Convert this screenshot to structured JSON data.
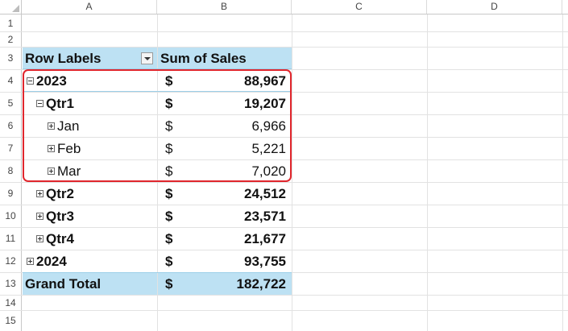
{
  "columns": [
    "A",
    "B",
    "C",
    "D"
  ],
  "rows": [
    "1",
    "2",
    "3",
    "4",
    "5",
    "6",
    "7",
    "8",
    "9",
    "10",
    "11",
    "12",
    "13",
    "14",
    "15"
  ],
  "pivot": {
    "header": {
      "row_labels": "Row Labels",
      "sum_of_sales": "Sum of Sales"
    },
    "entries": [
      {
        "label": "2023",
        "currency": "$",
        "value": "88,967"
      },
      {
        "label": "Qtr1",
        "currency": "$",
        "value": "19,207"
      },
      {
        "label": "Jan",
        "currency": "$",
        "value": "6,966"
      },
      {
        "label": "Feb",
        "currency": "$",
        "value": "5,221"
      },
      {
        "label": "Mar",
        "currency": "$",
        "value": "7,020"
      },
      {
        "label": "Qtr2",
        "currency": "$",
        "value": "24,512"
      },
      {
        "label": "Qtr3",
        "currency": "$",
        "value": "23,571"
      },
      {
        "label": "Qtr4",
        "currency": "$",
        "value": "21,677"
      },
      {
        "label": "2024",
        "currency": "$",
        "value": "93,755"
      }
    ],
    "grand_total": {
      "label": "Grand Total",
      "currency": "$",
      "value": "182,722"
    }
  },
  "colors": {
    "pivot_header_fill": "#bde1f3",
    "highlight_border": "#e0262d"
  }
}
